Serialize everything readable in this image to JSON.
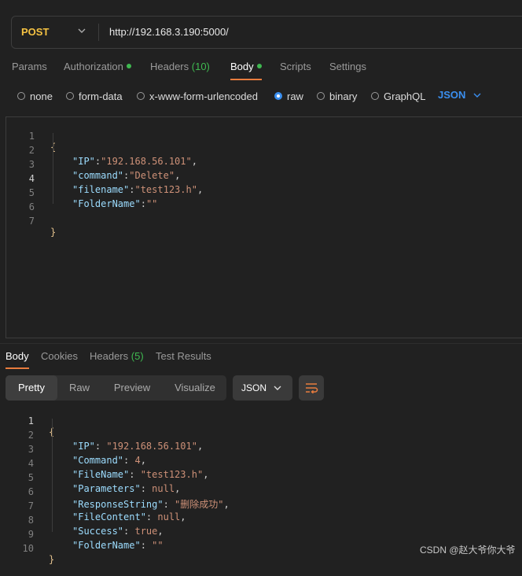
{
  "request": {
    "method": "POST",
    "url": "http://192.168.3.190:5000/"
  },
  "tabs": [
    {
      "label": "Params"
    },
    {
      "label": "Authorization",
      "dot": true
    },
    {
      "label": "Headers",
      "count": "(10)"
    },
    {
      "label": "Body",
      "dot": true,
      "active": true
    },
    {
      "label": "Scripts"
    },
    {
      "label": "Settings"
    }
  ],
  "body_modes": {
    "options": [
      "none",
      "form-data",
      "x-www-form-urlencoded",
      "raw",
      "binary",
      "GraphQL"
    ],
    "selected": "raw",
    "language": "JSON"
  },
  "request_body": {
    "line_numbers": [
      "1",
      "2",
      "3",
      "4",
      "5",
      "6",
      "7"
    ],
    "current_line": "4",
    "open": "{",
    "close": "}",
    "entries": [
      {
        "key": "\"IP\"",
        "value": "\"192.168.56.101\"",
        "trail": ","
      },
      {
        "key": "\"command\"",
        "value": "\"Delete\"",
        "trail": ","
      },
      {
        "key": "\"filename\"",
        "value": "\"test123.h\"",
        "trail": ","
      },
      {
        "key": "\"FolderName\"",
        "value": "\"\"",
        "trail": ""
      }
    ]
  },
  "response": {
    "tabs": [
      {
        "label": "Body",
        "active": true
      },
      {
        "label": "Cookies"
      },
      {
        "label": "Headers",
        "count": "(5)"
      },
      {
        "label": "Test Results"
      }
    ],
    "views": [
      "Pretty",
      "Raw",
      "Preview",
      "Visualize"
    ],
    "active_view": "Pretty",
    "format": "JSON",
    "line_numbers": [
      "1",
      "2",
      "3",
      "4",
      "5",
      "6",
      "7",
      "8",
      "9",
      "10"
    ],
    "current_line": "1",
    "open": "{",
    "close": "}",
    "entries": [
      {
        "key": "\"IP\"",
        "value": "\"192.168.56.101\"",
        "trail": ","
      },
      {
        "key": "\"Command\"",
        "value": "4",
        "trail": ","
      },
      {
        "key": "\"FileName\"",
        "value": "\"test123.h\"",
        "trail": ","
      },
      {
        "key": "\"Parameters\"",
        "value": "null",
        "trail": ","
      },
      {
        "key": "\"ResponseString\"",
        "value": "\"删除成功\"",
        "trail": ","
      },
      {
        "key": "\"FileContent\"",
        "value": "null",
        "trail": ","
      },
      {
        "key": "\"Success\"",
        "value": "true",
        "trail": ","
      },
      {
        "key": "\"FolderName\"",
        "value": "\"\"",
        "trail": ""
      }
    ]
  },
  "watermark": "CSDN @赵大爷你大爷",
  "colors": {
    "method": "#f5c242",
    "accent_orange": "#e87c3e",
    "accent_blue": "#3a8ff0",
    "dot_green": "#3fb950",
    "json_key": "#9cdcfe",
    "json_string": "#ce9178"
  }
}
